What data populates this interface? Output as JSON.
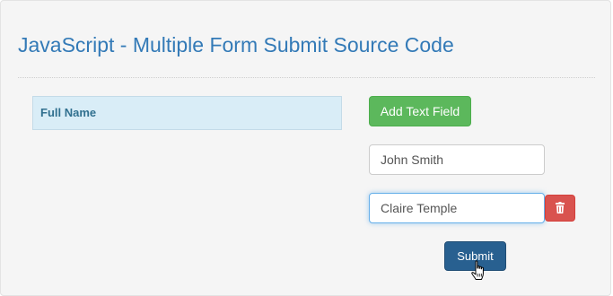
{
  "page": {
    "title": "JavaScript - Multiple Form Submit Source Code"
  },
  "table": {
    "header": "Full Name"
  },
  "buttons": {
    "add_label": "Add Text Field",
    "submit_label": "Submit",
    "delete_icon": "trash-icon"
  },
  "fields": [
    {
      "value": "John Smith"
    },
    {
      "value": "Claire Temple"
    }
  ],
  "colors": {
    "title": "#337ab7",
    "add_button": "#5cb85c",
    "delete_button": "#d9534f",
    "submit_button": "#286090",
    "table_header_bg": "#d9edf7"
  }
}
